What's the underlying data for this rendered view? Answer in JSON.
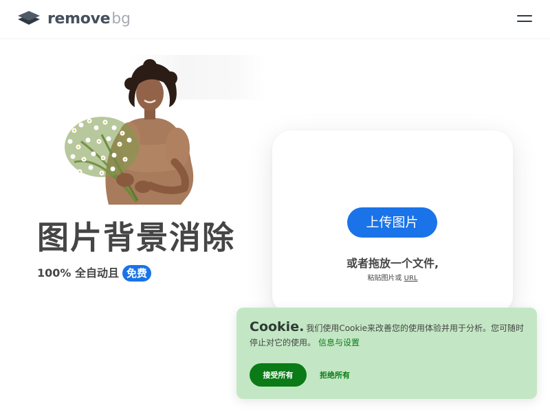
{
  "header": {
    "logo": {
      "word1": "remove",
      "word2": "bg",
      "icon": "removebg-logo-icon"
    },
    "menu_icon": "hamburger-menu-icon"
  },
  "hero": {
    "image": "woman-holding-flowers-photo",
    "title": "图片背景消除",
    "subtitle_prefix": "100% 全自动且",
    "free_badge": "免费"
  },
  "upload": {
    "button_label": "上传图片",
    "drop_text": "或者拖放一个文件,",
    "paste_prefix": "粘贴图片或",
    "url_link": "URL"
  },
  "cookie_banner": {
    "title": "Cookie.",
    "message": "我们使用Cookie来改善您的使用体验并用于分析。您可随时停止对它的使用。",
    "settings_link": "信息与设置",
    "accept_label": "接受所有",
    "reject_label": "拒绝所有"
  },
  "colors": {
    "accent_blue": "#1a73e8",
    "cookie_bg": "#c3e7c4",
    "cookie_green": "#0a7b16",
    "text_dark": "#454545"
  }
}
